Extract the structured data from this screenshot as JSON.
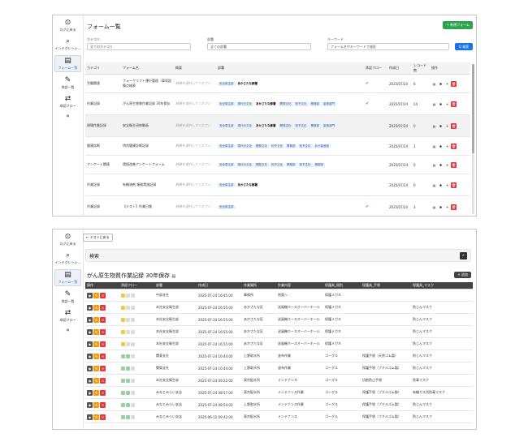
{
  "sidebar": {
    "items": [
      {
        "icon": "⊙",
        "label": "ログに戻る"
      },
      {
        "icon": "⌕",
        "label": "インテグレーシ..."
      },
      {
        "icon": "▤",
        "label": "フォーム一覧"
      },
      {
        "icon": "✎",
        "label": "承認一覧"
      },
      {
        "icon": "⇄",
        "label": "承認フロー"
      }
    ],
    "collapse": "«"
  },
  "screen1": {
    "title": "フォーム一覧",
    "new_button": "+ 新規フォーム",
    "filters": [
      {
        "label": "カテゴリ",
        "value": "全てのカテゴリ"
      },
      {
        "label": "部署",
        "value": "全ての部署"
      },
      {
        "label": "キーワード",
        "value": "フォーム名やキーワードで検索"
      }
    ],
    "search_button": "Q 検索",
    "columns": [
      "カテゴリ",
      "フォーム名",
      "概要",
      "部署",
      "承認フロー",
      "作成日",
      "レコード数",
      "操作"
    ],
    "rows": [
      {
        "category": "労働関連",
        "name": "フォークリフト運行管理（車両設備点検表",
        "summary": "概要を選択してください",
        "depts": [
          "安全衛生部",
          "あかさたな部署",
          ""
        ],
        "flow": true,
        "date": "2025/07/24",
        "count": "6"
      },
      {
        "category": "作業記録",
        "name": "がん原生物質作業記録 30年保存",
        "summary": "概要を選択してください",
        "depts": [
          "安全衛生部",
          "現代分文化",
          "あかさたな部署",
          "開発文化",
          "知予文化",
          "業務部",
          "製造部門"
        ],
        "flow": true,
        "date": "2025/07/24",
        "count": "24"
      },
      {
        "category": "現場作業記録",
        "name": "安全衛生研修動画",
        "summary": "概要を選択してください",
        "depts": [
          "安全衛生部",
          "現代分文化",
          "あかさたな部署",
          "開発文化",
          "知予文化",
          "業務部",
          "製造部門"
        ],
        "flow": false,
        "date": "2025/07/24",
        "count": "0"
      },
      {
        "category": "健康診断",
        "name": "特別健康診断記録",
        "summary": "概要を選択してください",
        "depts": [
          "安全衛生部",
          "現代分文化",
          "開発文化",
          "知予文化",
          "業務部",
          "知予文化",
          "あか製造部"
        ],
        "flow": false,
        "date": "2025/07/24",
        "count": "1"
      },
      {
        "category": "アンケート関連",
        "name": "環境改善アンケートフォーム",
        "summary": "概要を選択してください",
        "depts": [
          "安全衛生部",
          "現代分文化",
          "開発文化",
          "知予文化",
          "業務部",
          "知予文化",
          "業務部"
        ],
        "flow": false,
        "date": "2025/07/24",
        "count": "0"
      },
      {
        "category": "作業記録",
        "name": "有機溶剤 業務実施記録",
        "summary": "概要を選択してください",
        "depts": [
          "安全衛生部",
          "あかさたな部署"
        ],
        "flow": false,
        "date": "2025/07/24",
        "count": "0"
      },
      {
        "category": "作業記録",
        "name": "【テスト】作業日報",
        "summary": "概要を選択してください",
        "depts": [
          "安全衛生部"
        ],
        "flow": true,
        "date": "2025/07/24",
        "count": "3"
      }
    ]
  },
  "screen2": {
    "back_button": "← テストに戻る",
    "search_label": "検索",
    "title": "がん原生物質作業記録 30年保存",
    "add_button": "+ 追加",
    "columns": [
      "操作",
      "承認フロー",
      "部署",
      "作成日",
      "作業場所",
      "作業内容",
      "保護具_個別",
      "保護具_手袋",
      "保護具_マスク"
    ],
    "rows": [
      {
        "flow": "y",
        "dept": "中部支社",
        "date": "2025-07-24 16:45:00",
        "place": "事務所",
        "work": "除菌へ",
        "ind": "保護メガネ",
        "glove": "",
        "mask": ""
      },
      {
        "flow": "y",
        "dept": "本社安全衛生部",
        "date": "2025-07-24 16:55:00",
        "place": "あかさたな区",
        "work": "送風機ホースオーバーホール",
        "ind": "保護メガネ",
        "glove": "",
        "mask": "防じんマスク"
      },
      {
        "flow": "y",
        "dept": "本社安全衛生部",
        "date": "2025-07-24 16:55:00",
        "place": "あかさたな区",
        "work": "送風機ホースオーバーホール",
        "ind": "保護メガネ",
        "glove": "",
        "mask": "防じんマスク"
      },
      {
        "flow": "y",
        "dept": "本社安全衛生部",
        "date": "2025-07-24 16:55:00",
        "place": "あかさたな区",
        "work": "送風機ホースオーバーホール",
        "ind": "保護メガネ",
        "glove": "",
        "mask": "防じんマスク"
      },
      {
        "flow": "y",
        "dept": "本社安全衛生部",
        "date": "2025-07-24 16:55:00",
        "place": "あかさたな区",
        "work": "送風機ホースオーバーホール",
        "ind": "保護メガネ",
        "glove": "",
        "mask": "防じんマスク"
      },
      {
        "flow": "g",
        "dept": "関東支社",
        "date": "2025-07-24 10:44:00",
        "place": "上野取水所",
        "work": "塗布作業",
        "ind": "ゴーグル",
        "glove": "保護手袋（天然ゴム製）",
        "mask": "防じんマスク"
      },
      {
        "flow": "g",
        "dept": "関東支社",
        "date": "2025-07-24 10:44:00",
        "place": "上野取水所",
        "work": "塗布作業",
        "ind": "ゴーグル",
        "glove": "保護手袋（ブチルゴム製）",
        "mask": "防じんマスク"
      },
      {
        "flow": "g",
        "dept": "本社安全衛生部",
        "date": "2025-07-24 09:22:00",
        "place": "東京配水所",
        "work": "メンテナンス",
        "ind": "ゴーグル",
        "glove": "切創防止手袋",
        "mask": "防毒マスク"
      },
      {
        "flow": "g",
        "dept": "みなとみらい支店",
        "date": "2025-07-24 08:57:00",
        "place": "東京配水所",
        "work": "メンテナンス作業",
        "ind": "ゴーグル",
        "glove": "保護手袋（ブチルゴム製）",
        "mask": "有機ガス用防毒マスク"
      },
      {
        "flow": "g",
        "dept": "みなとみらい支店",
        "date": "2025-07-24 08:54:00",
        "place": "上野取水所",
        "work": "メンテナンス作業",
        "ind": "ゴーグル",
        "glove": "保護手袋（ブチルゴム製）",
        "mask": "防じんマスク"
      },
      {
        "flow": "g",
        "dept": "みなとみらい支店",
        "date": "2025-06-12 09:42:00",
        "place": "東京配水所",
        "work": "メンテナンス",
        "ind": "ゴーグル",
        "glove": "保護手袋（ブチルゴム製）",
        "mask": "防じんマスク"
      }
    ]
  }
}
